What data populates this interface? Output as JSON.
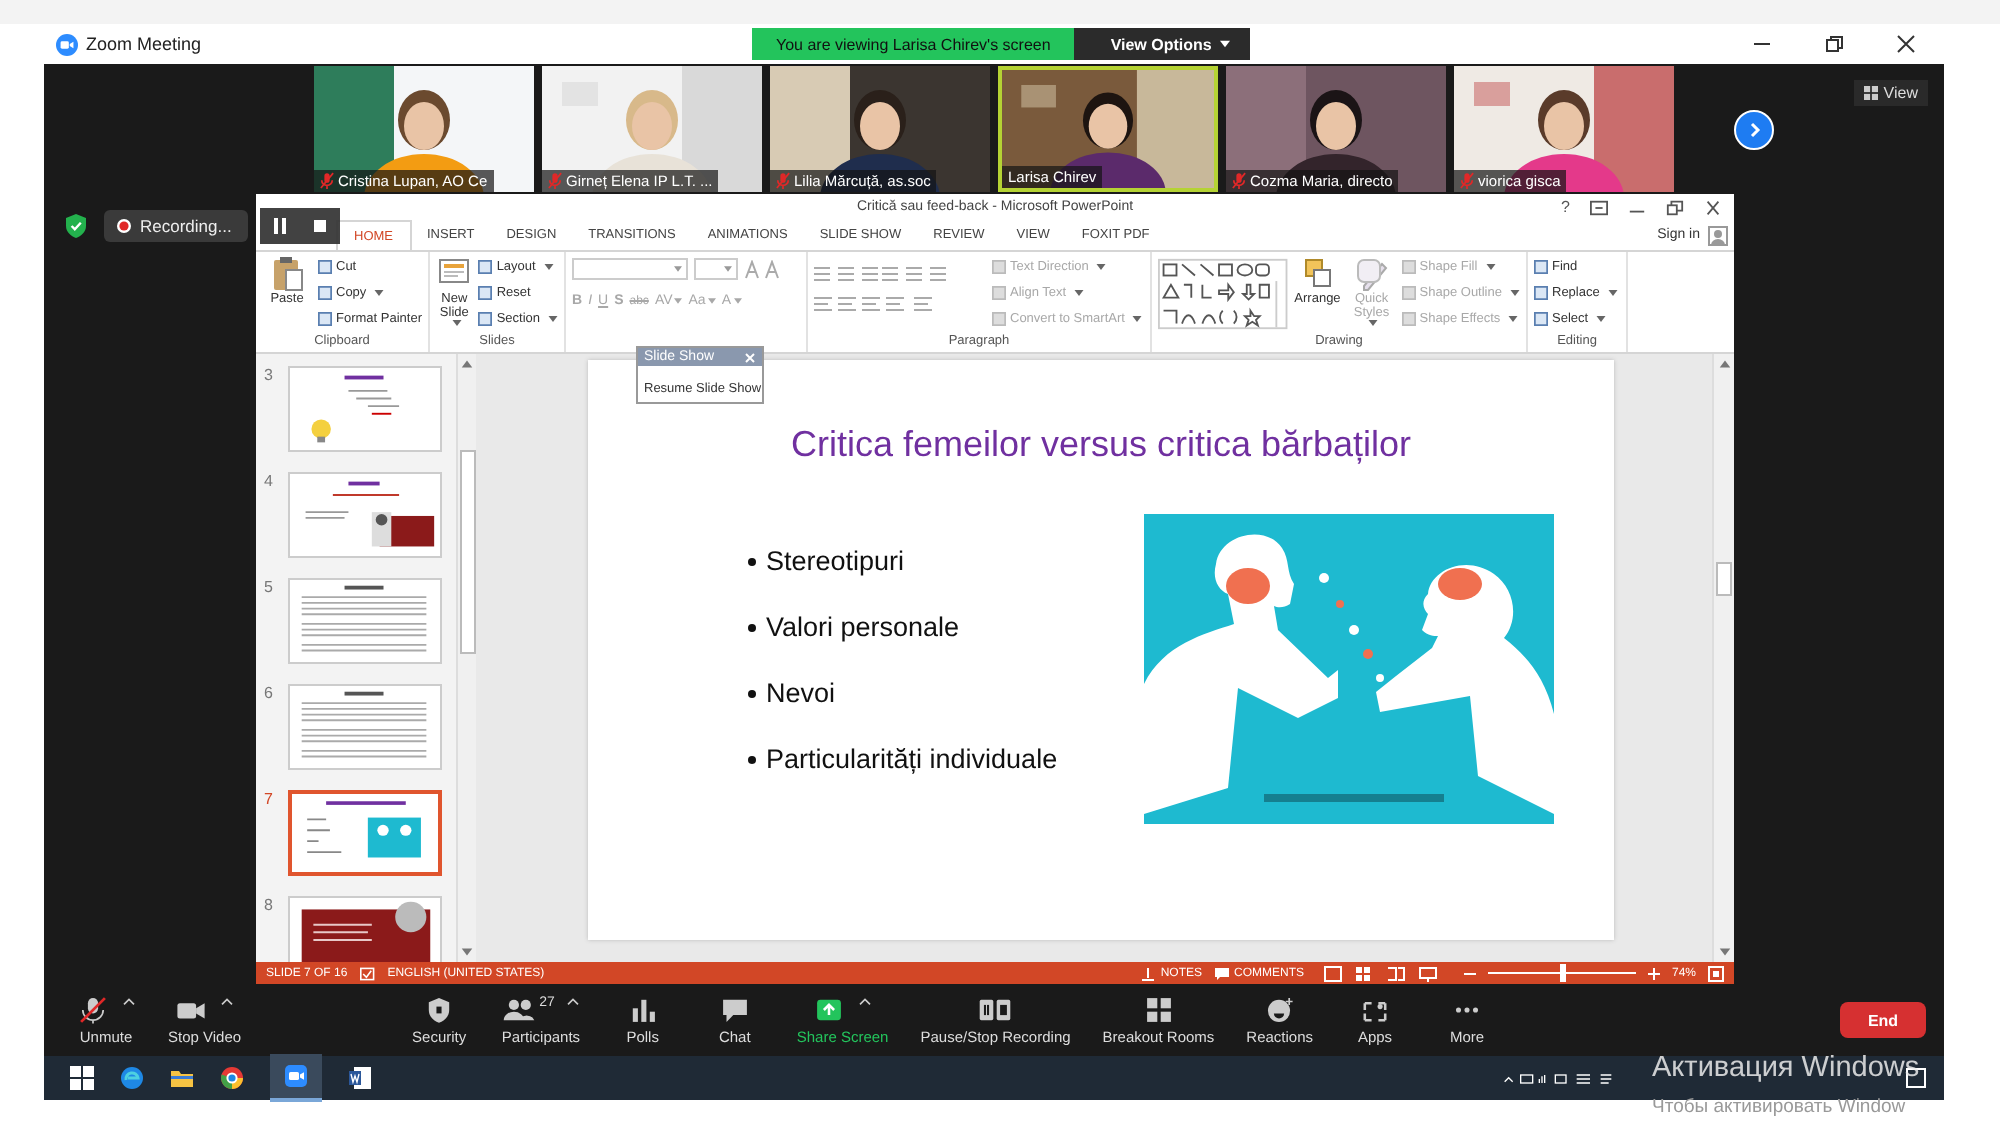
{
  "window": {
    "title": "Zoom Meeting"
  },
  "share_banner": {
    "text": "You are viewing Larisa Chirev's screen",
    "view_options": "View Options"
  },
  "view_button": "View",
  "participants_strip": [
    {
      "name": "Cristina Lupan, AO Ce",
      "muted": true,
      "active_speaker": false
    },
    {
      "name": "Girneț Elena  IP L.T. ...",
      "muted": true,
      "active_speaker": false
    },
    {
      "name": "Lilia Mărcuță, as.soc",
      "muted": true,
      "active_speaker": false
    },
    {
      "name": "Larisa Chirev",
      "muted": false,
      "active_speaker": true
    },
    {
      "name": "Cozma Maria, directo",
      "muted": true,
      "active_speaker": false
    },
    {
      "name": "viorica gisca",
      "muted": true,
      "active_speaker": false
    }
  ],
  "recording": {
    "label": "Recording..."
  },
  "powerpoint": {
    "title": "Critică sau feed-back - Microsoft PowerPoint",
    "help": "?",
    "sign_in": "Sign in",
    "tabs": [
      {
        "label": "HOME",
        "selected": true
      },
      {
        "label": "INSERT",
        "selected": false
      },
      {
        "label": "DESIGN",
        "selected": false
      },
      {
        "label": "TRANSITIONS",
        "selected": false
      },
      {
        "label": "ANIMATIONS",
        "selected": false
      },
      {
        "label": "SLIDE SHOW",
        "selected": false
      },
      {
        "label": "REVIEW",
        "selected": false
      },
      {
        "label": "VIEW",
        "selected": false
      },
      {
        "label": "FOXIT PDF",
        "selected": false
      }
    ],
    "ribbon": [
      {
        "kind": "clipboard",
        "label": "Clipboard",
        "items": [
          {
            "label": "Paste",
            "disabled": false,
            "dropdown": false
          },
          {
            "label": "Cut",
            "disabled": false,
            "dropdown": false
          },
          {
            "label": "Copy",
            "disabled": false,
            "dropdown": true
          },
          {
            "label": "Format Painter",
            "disabled": false,
            "dropdown": false
          }
        ]
      },
      {
        "kind": "slides",
        "label": "Slides",
        "items": [
          {
            "label": "New Slide",
            "disabled": false,
            "dropdown": true
          },
          {
            "label": "Layout",
            "disabled": false,
            "dropdown": true
          },
          {
            "label": "Reset",
            "disabled": false,
            "dropdown": false
          },
          {
            "label": "Section",
            "disabled": false,
            "dropdown": true
          }
        ]
      },
      {
        "kind": "font",
        "items": [
          {
            "label": "B",
            "disabled": true,
            "dropdown": false
          },
          {
            "label": "I",
            "disabled": true,
            "dropdown": false
          },
          {
            "label": "U",
            "disabled": true,
            "dropdown": false
          },
          {
            "label": "S",
            "disabled": true,
            "dropdown": false
          },
          {
            "label": "abc",
            "disabled": true,
            "dropdown": false
          },
          {
            "label": "AV",
            "disabled": true,
            "dropdown": true
          },
          {
            "label": "Aa",
            "disabled": true,
            "dropdown": true
          },
          {
            "label": "A",
            "disabled": true,
            "dropdown": true
          }
        ]
      },
      {
        "kind": "paragraph",
        "label": "Paragraph",
        "items": [
          {
            "label": "Text Direction",
            "disabled": true,
            "dropdown": true
          },
          {
            "label": "Align Text",
            "disabled": true,
            "dropdown": true
          },
          {
            "label": "Convert to SmartArt",
            "disabled": true,
            "dropdown": true
          }
        ]
      },
      {
        "kind": "drawing",
        "label": "Drawing",
        "items": [
          {
            "label": "Arrange",
            "disabled": false,
            "dropdown": false
          },
          {
            "label": "Quick Styles",
            "disabled": true,
            "dropdown": true
          },
          {
            "label": "Shape Fill",
            "disabled": true,
            "dropdown": true
          },
          {
            "label": "Shape Outline",
            "disabled": true,
            "dropdown": true
          },
          {
            "label": "Shape Effects",
            "disabled": true,
            "dropdown": true
          }
        ]
      },
      {
        "kind": "editing",
        "label": "Editing",
        "items": [
          {
            "label": "Find",
            "disabled": false,
            "dropdown": false
          },
          {
            "label": "Replace",
            "disabled": false,
            "dropdown": true
          },
          {
            "label": "Select",
            "disabled": false,
            "dropdown": true
          }
        ]
      }
    ],
    "slide_show_toolbar": {
      "title": "Slide Show",
      "item": "Resume Slide Show"
    },
    "thumbnails": [
      {
        "number": "3",
        "kind": "bulb",
        "selected": false
      },
      {
        "number": "4",
        "kind": "portrait",
        "selected": false
      },
      {
        "number": "5",
        "kind": "text",
        "selected": false
      },
      {
        "number": "6",
        "kind": "text",
        "selected": false
      },
      {
        "number": "7",
        "kind": "illustration",
        "selected": true
      },
      {
        "number": "8",
        "kind": "quote",
        "selected": false
      }
    ],
    "slide": {
      "title": "Critica femeilor versus critica bărbaților",
      "bullets": [
        "Stereotipuri",
        "Valori personale",
        "Nevoi",
        "Particularități individuale"
      ]
    },
    "status_bar": {
      "slide": "SLIDE 7 OF 16",
      "language": "ENGLISH (UNITED STATES)",
      "notes": "NOTES",
      "comments": "COMMENTS",
      "zoom": "74%",
      "level": 0.5
    }
  },
  "toolbar": [
    {
      "kind": "mic-muted",
      "label": "Unmute",
      "caret": true
    },
    {
      "kind": "video",
      "label": "Stop Video",
      "caret": true
    },
    {
      "kind": "security",
      "label": "Security",
      "caret": false
    },
    {
      "kind": "participants",
      "label": "Participants",
      "count": "27",
      "caret": true
    },
    {
      "kind": "polls",
      "label": "Polls",
      "caret": false
    },
    {
      "kind": "chat",
      "label": "Chat",
      "caret": false
    },
    {
      "kind": "share",
      "label": "Share Screen",
      "caret": true
    },
    {
      "kind": "record",
      "label": "Pause/Stop Recording",
      "caret": false
    },
    {
      "kind": "breakout",
      "label": "Breakout Rooms",
      "caret": false
    },
    {
      "kind": "reactions",
      "label": "Reactions",
      "caret": false
    },
    {
      "kind": "apps",
      "label": "Apps",
      "caret": false
    },
    {
      "kind": "more",
      "label": "More",
      "caret": false
    }
  ],
  "end_button": "End",
  "activation_notice": {
    "title": "Активация Windows",
    "text": "Чтобы активировать Window"
  }
}
